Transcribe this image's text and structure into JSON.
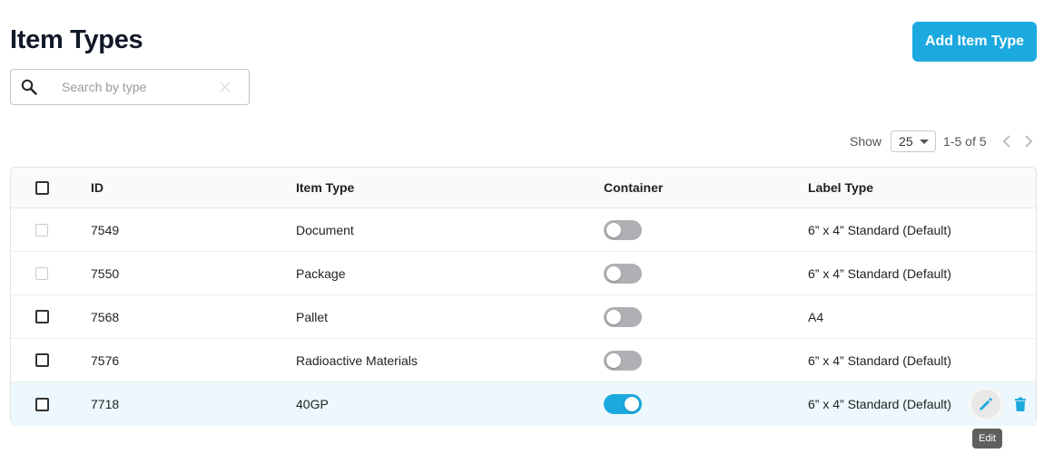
{
  "page": {
    "title": "Item Types"
  },
  "toolbar": {
    "add_label": "Add Item Type"
  },
  "search": {
    "placeholder": "Search by type",
    "value": ""
  },
  "pager": {
    "show_label": "Show",
    "page_size": "25",
    "range": "1-5 of 5"
  },
  "table": {
    "columns": [
      "ID",
      "Item Type",
      "Container",
      "Label Type"
    ],
    "rows": [
      {
        "id": "7549",
        "item_type": "Document",
        "container": false,
        "label_type": "6” x 4” Standard (Default)",
        "checkbox_disabled": true
      },
      {
        "id": "7550",
        "item_type": "Package",
        "container": false,
        "label_type": "6” x 4” Standard (Default)",
        "checkbox_disabled": true
      },
      {
        "id": "7568",
        "item_type": "Pallet",
        "container": false,
        "label_type": "A4",
        "checkbox_disabled": false
      },
      {
        "id": "7576",
        "item_type": "Radioactive Materials",
        "container": false,
        "label_type": "6” x 4” Standard (Default)",
        "checkbox_disabled": false
      },
      {
        "id": "7718",
        "item_type": "40GP",
        "container": true,
        "label_type": "6” x 4” Standard (Default)",
        "checkbox_disabled": false
      }
    ]
  },
  "tooltip": {
    "text": "Edit"
  },
  "colors": {
    "accent": "#1ba9df",
    "toggle_off": "#b0b0b4",
    "active_row": "#ecf8fd"
  },
  "icons": {
    "search": "search-icon",
    "clear": "close-icon",
    "prev": "chevron-left-icon",
    "next": "chevron-right-icon",
    "edit": "pencil-icon",
    "delete": "trash-icon"
  }
}
